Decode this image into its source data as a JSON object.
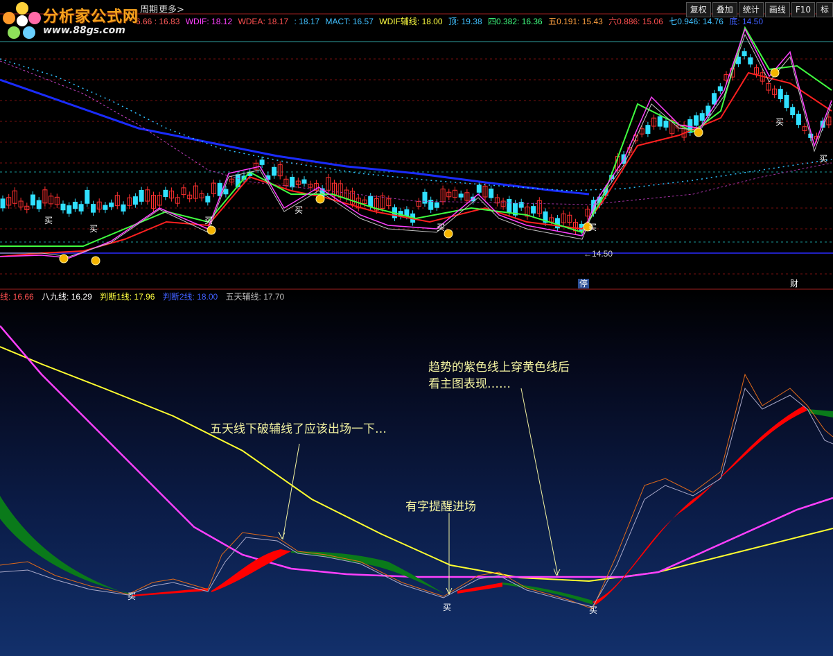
{
  "logo": {
    "title": "分析家公式网",
    "url": "www.88gs.com"
  },
  "menu": {
    "period": "周期",
    "more": "更多>"
  },
  "toolbar": [
    {
      "label": "复权"
    },
    {
      "label": "叠加"
    },
    {
      "label": "统计"
    },
    {
      "label": "画线"
    },
    {
      "label": "F10"
    },
    {
      "label": "标"
    }
  ],
  "indicators": [
    {
      "text": "6.66 : 16.83",
      "color": "#ff5a5a"
    },
    {
      "text": "WDIF: 18.12",
      "color": "#ff40ff"
    },
    {
      "text": "WDEA: 18.17",
      "color": "#ff5050"
    },
    {
      "text": ": 18.17",
      "color": "#40c0ff"
    },
    {
      "text": "MACT: 16.57",
      "color": "#40c0ff"
    },
    {
      "text": "WDIF辅线: 18.00",
      "color": "#ffff40"
    },
    {
      "text": "顶: 19.38",
      "color": "#40c0ff"
    },
    {
      "text": "四0.382: 16.36",
      "color": "#40ff80"
    },
    {
      "text": "五0.191: 15.43",
      "color": "#ffa040"
    },
    {
      "text": "六0.886: 15.06",
      "color": "#ff5050"
    },
    {
      "text": "七0.946: 14.76",
      "color": "#40c0ff"
    },
    {
      "text": "底: 14.50",
      "color": "#4060ff"
    }
  ],
  "bottom_legend": [
    {
      "text": "线: 16.66",
      "color": "#ff5050"
    },
    {
      "text": "八九线: 16.29",
      "color": "#ffffff"
    },
    {
      "text": "判断1线: 17.96",
      "color": "#ffff40"
    },
    {
      "text": "判断2线: 18.00",
      "color": "#4060ff"
    },
    {
      "text": "五天辅线: 17.70",
      "color": "#bbbbbb"
    }
  ],
  "price_low_label": "←14.50",
  "tags": {
    "stop": "停",
    "fin": "财"
  },
  "buy_label": "买",
  "annotations": {
    "trend": [
      "趋势的紫色线上穿黄色线后",
      "看主图表现……"
    ],
    "exit": "五天线下破辅线了应该出场一下…",
    "entry": "有字提醒进场"
  },
  "colors": {
    "up": "#ff3030",
    "down": "#30e0ff",
    "ma_blue": "#1a2cff",
    "ma_red": "#ff2020",
    "ma_green": "#40ff40",
    "purple": "#ff40ff",
    "yellow": "#ffff30",
    "band_red": "#ff0000",
    "band_green": "#0a7a1a"
  }
}
